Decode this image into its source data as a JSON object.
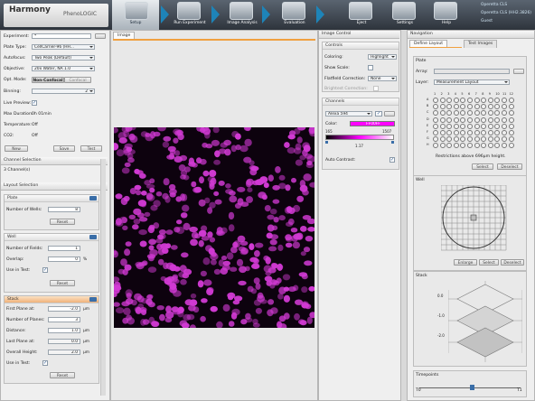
{
  "header": {
    "brand": "Harmony",
    "product": "PhenoLOGIC",
    "steps": [
      {
        "label": "Setup",
        "icon": "plate-icon",
        "active": true
      },
      {
        "label": "Run Experiment",
        "icon": "run-experiment-icon"
      },
      {
        "label": "Image Analysis",
        "icon": "image-analysis-icon"
      },
      {
        "label": "Evaluation",
        "icon": "evaluation-icon"
      },
      {
        "label": "Eject",
        "icon": "eject-icon"
      },
      {
        "label": "Settings",
        "icon": "settings-icon"
      },
      {
        "label": "Help",
        "icon": "help-icon"
      }
    ],
    "links": [
      "Operetta CLS",
      "Operetta CLS (HH2.3826)",
      "Guest"
    ]
  },
  "setup": {
    "experiment_label": "Experiment:",
    "experiment_value": "*",
    "plate_type_label": "Plate Type:",
    "plate_type_value": "CellCarrier-96 (HH...",
    "autofocus_label": "Autofocus:",
    "autofocus_value": "Two Peak (Default)",
    "objective_label": "Objective:",
    "objective_value": "20x Water, NA 1.0",
    "optmode_label": "Opt. Mode:",
    "optmode_options": [
      "Non-Confocal",
      "Confocal"
    ],
    "binning_label": "Binning:",
    "binning_value": "2",
    "live_preview_label": "Live Preview:",
    "max_duration_label": "Max Duration:",
    "max_duration_value": "0h 01min",
    "temperature_label": "Temperature:",
    "temperature_value": "Off",
    "co2_label": "CO2:",
    "co2_value": "Off",
    "buttons": {
      "new": "New",
      "save": "Save",
      "test": "Test"
    }
  },
  "channel_selection": {
    "title": "Channel Selection",
    "summary": "3 Channel(s)"
  },
  "layout_selection": {
    "title": "Layout Selection",
    "plate_section": "Plate",
    "number_of_wells_label": "Number of Wells:",
    "number_of_wells_value": "8",
    "well_section": "Well",
    "number_of_fields_label": "Number of Fields:",
    "number_of_fields_value": "1",
    "overlap_label": "Overlap:",
    "overlap_value": "0",
    "overlap_unit": "%",
    "use_in_test_label": "Use in Test:",
    "reset": "Reset"
  },
  "stack": {
    "title": "Stack",
    "first_plane_label": "First Plane at:",
    "first_plane_value": "-2.0",
    "number_of_planes_label": "Number of Planes:",
    "number_of_planes_value": "3",
    "distance_label": "Distance:",
    "distance_value": "1.0",
    "last_plane_label": "Last Plane at:",
    "last_plane_value": "0.0",
    "overall_height_label": "Overall Height:",
    "overall_height_value": "2.0",
    "unit": "µm",
    "use_in_test_label": "Use in Test:",
    "reset": "Reset"
  },
  "image_panel": {
    "tab": "Image",
    "image_color": "#d23ad4"
  },
  "image_control": {
    "title": "Image Control",
    "controls_section": "Controls",
    "coloring_label": "Coloring:",
    "coloring_value": "Highlight",
    "show_scale_label": "Show Scale:",
    "flatfield_label": "Flatfield Correction:",
    "flatfield_value": "None",
    "brightest_correction_label": "Brightest Correction:",
    "channels_section": "Channels",
    "channel_name": "Alexa 594",
    "color_label": "Color:",
    "color_value": "FF00FF",
    "color_hex": "#ff00ff",
    "range_low": "165",
    "range_high": "1507",
    "gamma": "1.17",
    "auto_contrast_label": "Auto Contrast:"
  },
  "navigation": {
    "title": "Navigation",
    "tabs": [
      "Define Layout",
      "Test Images"
    ],
    "plate_section": "Plate",
    "array_label": "Array:",
    "layer_label": "Layer:",
    "layer_value": "Measurement Layout",
    "plate_rows": [
      "A",
      "B",
      "C",
      "D",
      "E",
      "F",
      "G",
      "H"
    ],
    "plate_cols": [
      "1",
      "2",
      "3",
      "4",
      "5",
      "6",
      "7",
      "8",
      "9",
      "10",
      "11",
      "12"
    ],
    "restriction_text": "Restrictions above 696µm height.",
    "select": "Select",
    "deselect": "Deselect",
    "well_section": "Well",
    "enlarge": "Enlarge",
    "stack_section": "Stack",
    "stack_ticks": [
      "0.0",
      "-1.0",
      "-2.0"
    ],
    "timepoints_section": "Timepoints",
    "t0": "T0",
    "t1": "T1"
  }
}
